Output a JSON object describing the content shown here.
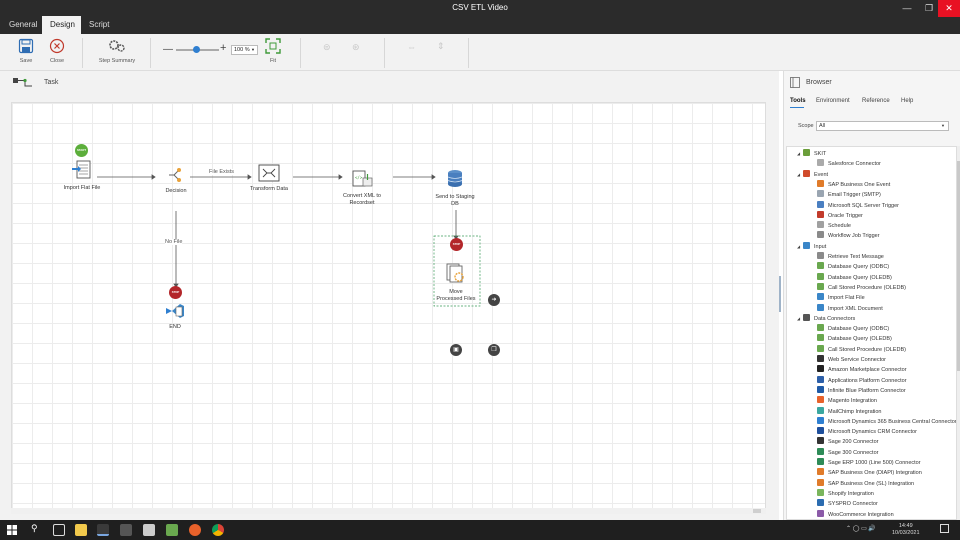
{
  "window": {
    "title": "CSV ETL Video",
    "tabs": [
      "General",
      "Design",
      "Script"
    ],
    "active_tab": "Design"
  },
  "toolbar": {
    "save_label": "Save",
    "close_label": "Close",
    "step_summary_label": "Step Summary",
    "zoom_value": "100 %",
    "fit_label": "Fit"
  },
  "canvas": {
    "task_label": "Task",
    "nodes": {
      "import_flat_file": "Import Flat File",
      "decision": "Decision",
      "transform_data": "Transform Data",
      "convert_xml": "Convert XML to\nRecordset",
      "send_to_staging": "Send to Staging\nDB",
      "move_processed": "Move\nProcessed Files",
      "end": "END"
    },
    "badges": {
      "start": "START",
      "stop": "STOP"
    },
    "edges": {
      "file_exists": "File Exists",
      "no_file": "No File"
    }
  },
  "browser": {
    "title": "Browser",
    "tabs": [
      "Tools",
      "Environment",
      "Reference",
      "Help"
    ],
    "active_tab": "Tools",
    "scope_label": "Scope",
    "scope_value": "All",
    "tree": [
      {
        "label": "SKIT",
        "group": true,
        "color": "#6b9e3a"
      },
      {
        "label": "Salesforce Connector",
        "color": "#aaaaaa"
      },
      {
        "label": "Event",
        "group": true,
        "color": "#d04a2b"
      },
      {
        "label": "SAP Business One Event",
        "color": "#e07b2a"
      },
      {
        "label": "Email Trigger (SMTP)",
        "color": "#9aa5b1"
      },
      {
        "label": "Microsoft SQL Server Trigger",
        "color": "#4a7fc1"
      },
      {
        "label": "Oracle Trigger",
        "color": "#c23b2b"
      },
      {
        "label": "Schedule",
        "color": "#a0a0a0"
      },
      {
        "label": "Workflow Job Trigger",
        "color": "#8a8a8a"
      },
      {
        "label": "Input",
        "group": true,
        "color": "#3a86c8"
      },
      {
        "label": "Retrieve Text Message",
        "color": "#8a8a8a"
      },
      {
        "label": "Database Query (ODBC)",
        "color": "#6aa84f"
      },
      {
        "label": "Database Query (OLEDB)",
        "color": "#6aa84f"
      },
      {
        "label": "Call Stored Procedure (OLEDB)",
        "color": "#6aa84f"
      },
      {
        "label": "Import Flat File",
        "color": "#3a86c8"
      },
      {
        "label": "Import XML Document",
        "color": "#3a86c8"
      },
      {
        "label": "Data Connectors",
        "group": true,
        "color": "#555555"
      },
      {
        "label": "Database Query (ODBC)",
        "color": "#6aa84f"
      },
      {
        "label": "Database Query (OLEDB)",
        "color": "#6aa84f"
      },
      {
        "label": "Call Stored Procedure (OLEDB)",
        "color": "#6aa84f"
      },
      {
        "label": "Web Service Connector",
        "color": "#333333"
      },
      {
        "label": "Amazon Marketplace Connector",
        "color": "#222222"
      },
      {
        "label": "Applications Platform Connector",
        "color": "#2d5fa8"
      },
      {
        "label": "Infinite Blue Platform Connector",
        "color": "#1f5aa6"
      },
      {
        "label": "Magento Integration",
        "color": "#e8622b"
      },
      {
        "label": "MailChimp Integration",
        "color": "#3aa7a0"
      },
      {
        "label": "Microsoft Dynamics 365 Business Central Connector",
        "color": "#2e7fd1"
      },
      {
        "label": "Microsoft Dynamics CRM Connector",
        "color": "#1e4f9c"
      },
      {
        "label": "Sage 200 Connector",
        "color": "#333333"
      },
      {
        "label": "Sage 300 Connector",
        "color": "#2e8b57"
      },
      {
        "label": "Sage ERP 1000 (Line 500) Connector",
        "color": "#2e8b57"
      },
      {
        "label": "SAP Business One (DIAPI) Integration",
        "color": "#e07b2a"
      },
      {
        "label": "SAP Business One (SL) Integration",
        "color": "#e07b2a"
      },
      {
        "label": "Shopify Integration",
        "color": "#7ab55c"
      },
      {
        "label": "SYSPRO Connector",
        "color": "#2b6cb0"
      },
      {
        "label": "WooCommerce Integration",
        "color": "#8b5aa8"
      }
    ]
  },
  "taskbar": {
    "time": "14:49",
    "date": "10/03/2021"
  }
}
